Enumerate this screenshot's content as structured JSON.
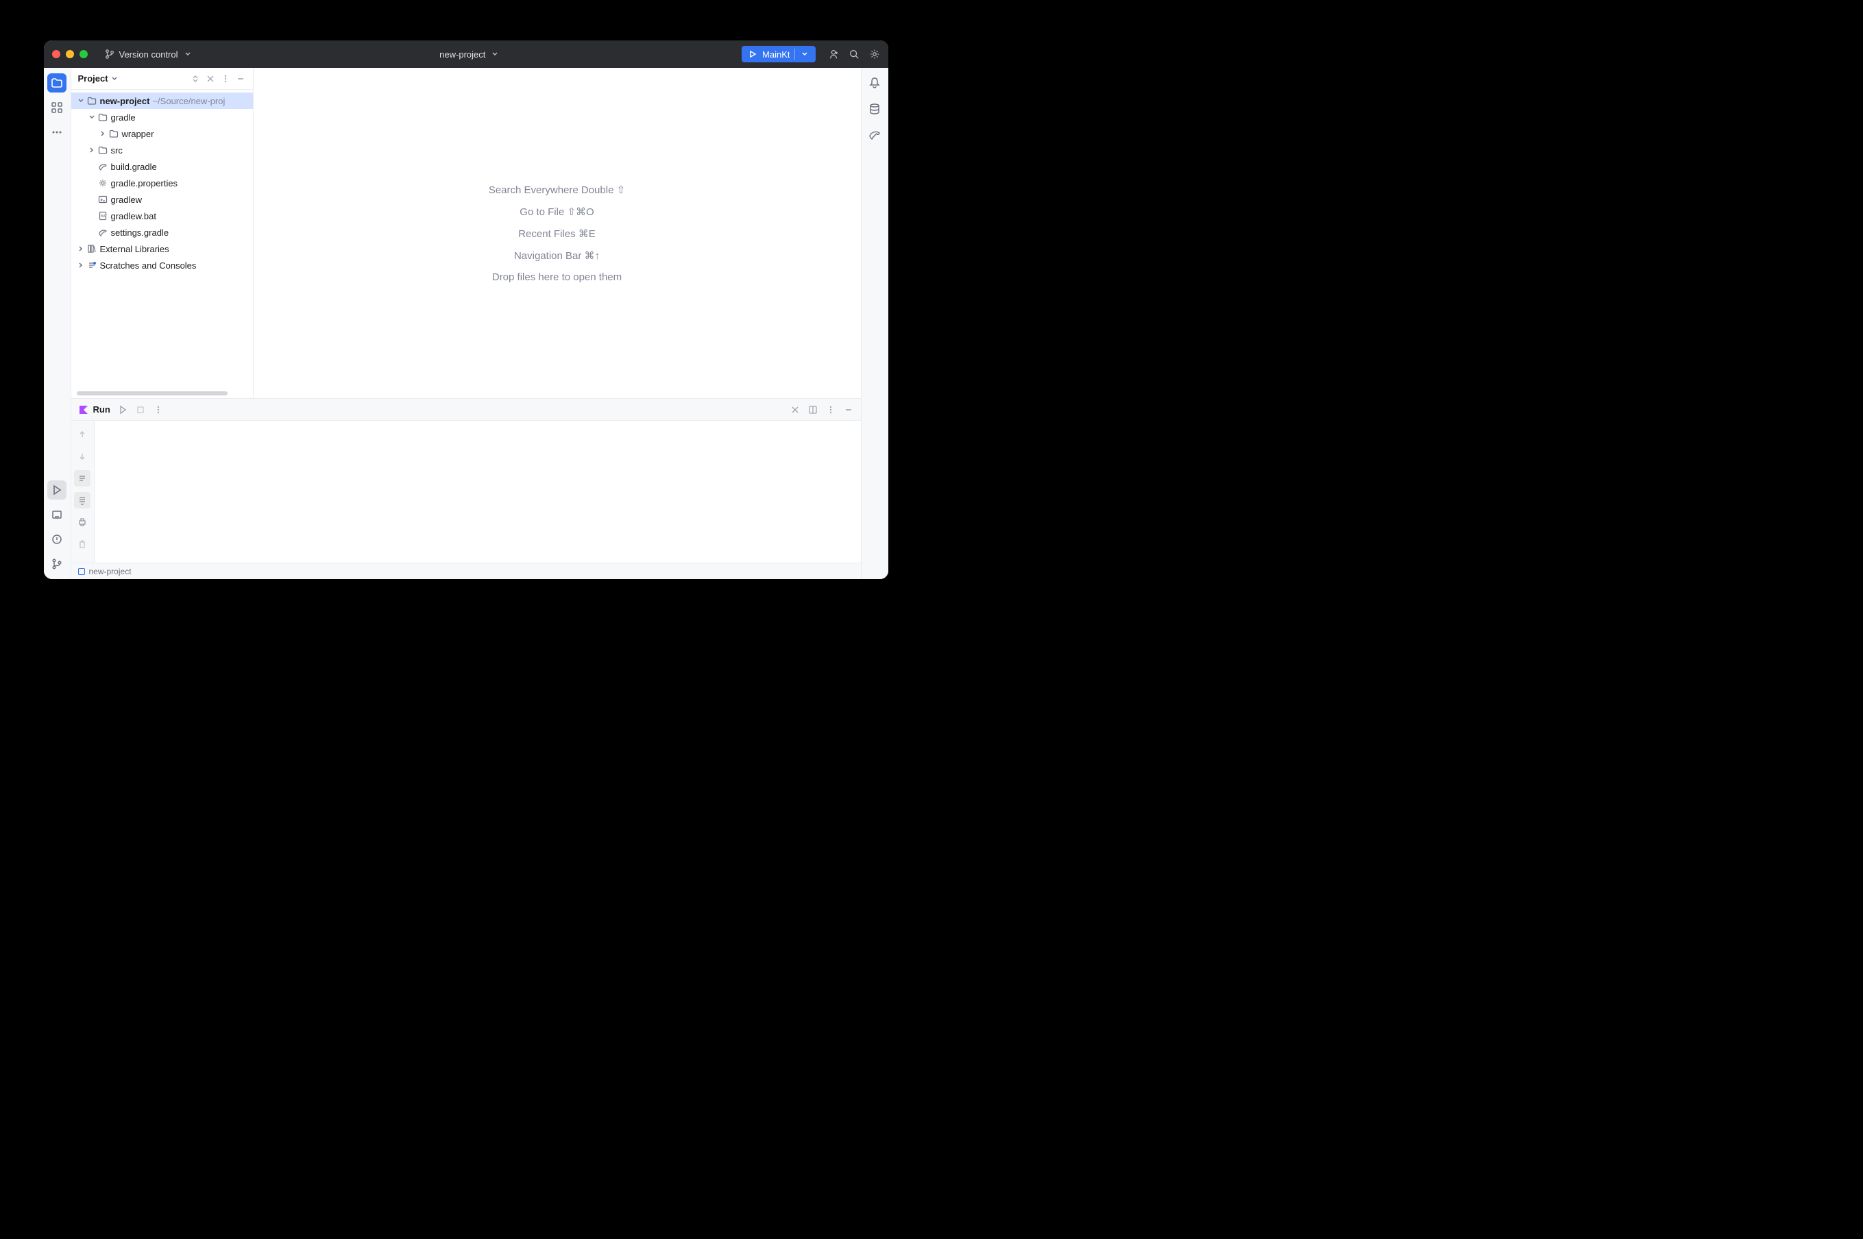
{
  "titlebar": {
    "version_control": "Version control",
    "project_name": "new-project",
    "run_config_label": "MainKt"
  },
  "project_panel": {
    "title": "Project",
    "root_name": "new-project",
    "root_path": "~/Source/new-proj",
    "items": {
      "gradle": "gradle",
      "wrapper": "wrapper",
      "src": "src",
      "build_gradle": "build.gradle",
      "gradle_properties": "gradle.properties",
      "gradlew": "gradlew",
      "gradlew_bat": "gradlew.bat",
      "settings_gradle": "settings.gradle",
      "external_libs": "External Libraries",
      "scratches": "Scratches and Consoles"
    }
  },
  "editor_hints": {
    "search": "Search Everywhere Double ⇧",
    "gotofile": "Go to File ⇧⌘O",
    "recent": "Recent Files ⌘E",
    "nav": "Navigation Bar ⌘↑",
    "drop": "Drop files here to open them"
  },
  "run_panel": {
    "title": "Run"
  },
  "statusbar": {
    "project": "new-project"
  }
}
